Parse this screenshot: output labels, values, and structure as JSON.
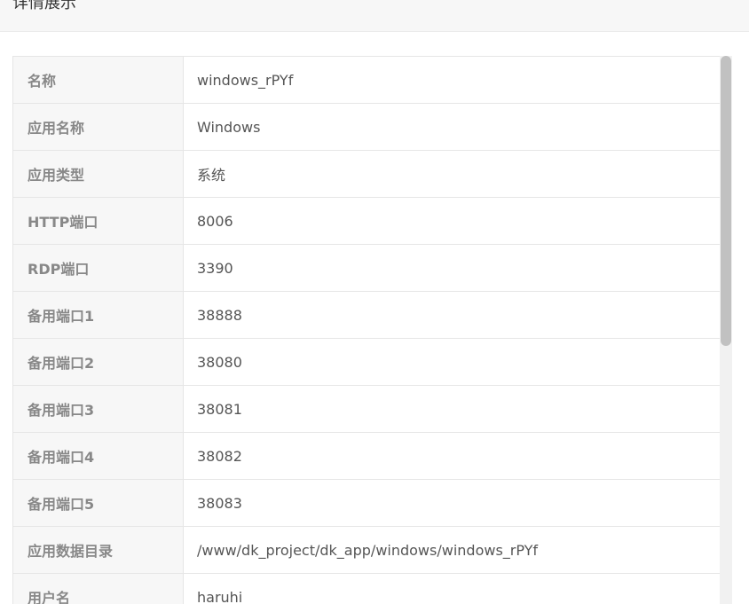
{
  "header": {
    "title": "详情展示"
  },
  "details": [
    {
      "label": "名称",
      "value": "windows_rPYf"
    },
    {
      "label": "应用名称",
      "value": "Windows"
    },
    {
      "label": "应用类型",
      "value": "系统"
    },
    {
      "label": "HTTP端口",
      "value": "8006"
    },
    {
      "label": "RDP端口",
      "value": "3390"
    },
    {
      "label": "备用端口1",
      "value": "38888"
    },
    {
      "label": "备用端口2",
      "value": "38080"
    },
    {
      "label": "备用端口3",
      "value": "38081"
    },
    {
      "label": "备用端口4",
      "value": "38082"
    },
    {
      "label": "备用端口5",
      "value": "38083"
    },
    {
      "label": "应用数据目录",
      "value": "/www/dk_project/dk_app/windows/windows_rPYf"
    },
    {
      "label": "用户名",
      "value": "haruhi"
    }
  ],
  "colors": {
    "label_bg": "#f7f7f7",
    "border": "#e6e6e6",
    "label_text": "#888888",
    "value_text": "#555555"
  }
}
